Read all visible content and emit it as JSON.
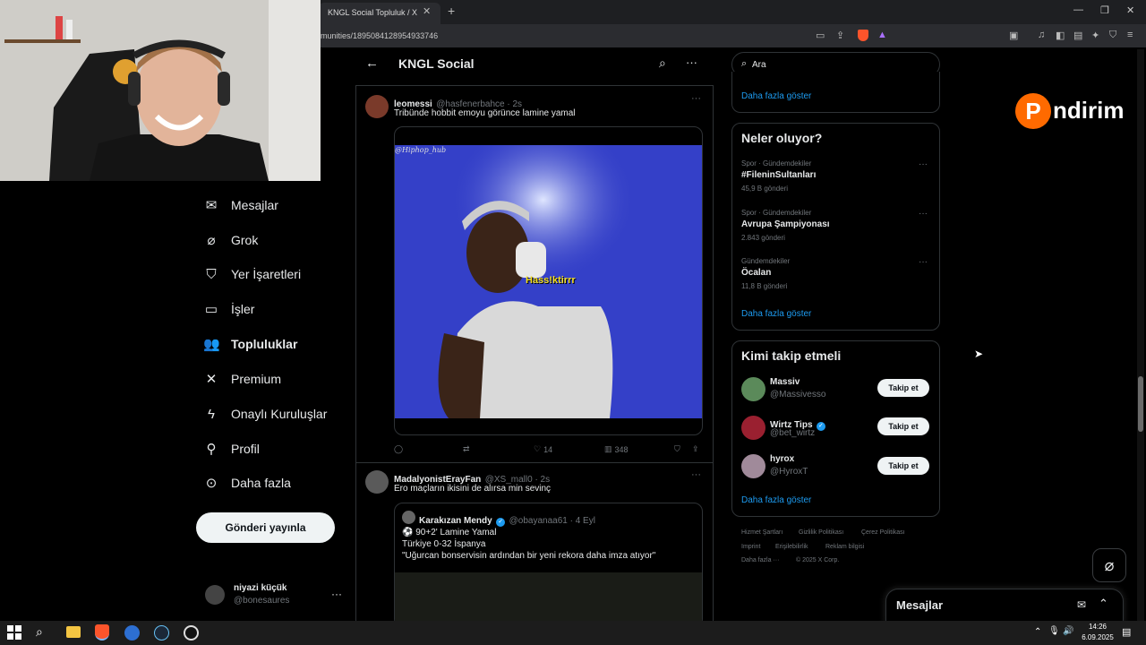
{
  "browser": {
    "tab_title": "KNGL Social Topluluk / X",
    "url": "munities/1895084128954933746"
  },
  "nav": {
    "items": [
      {
        "label": "Mesajlar",
        "icon": "envelope-icon"
      },
      {
        "label": "Grok",
        "icon": "grok-icon"
      },
      {
        "label": "Yer İşaretleri",
        "icon": "bookmark-icon"
      },
      {
        "label": "İşler",
        "icon": "briefcase-icon"
      },
      {
        "label": "Topluluklar",
        "icon": "people-icon"
      },
      {
        "label": "Premium",
        "icon": "x-logo-icon"
      },
      {
        "label": "Onaylı Kuruluşlar",
        "icon": "lightning-icon"
      },
      {
        "label": "Profil",
        "icon": "person-icon"
      },
      {
        "label": "Daha fazla",
        "icon": "more-circle-icon"
      }
    ],
    "post_button": "Gönderi yayınla",
    "account_name": "niyazi küçük",
    "account_handle": "@bonesaures"
  },
  "header": {
    "title": "KNGL Social"
  },
  "tweets": [
    {
      "name": "leomessi",
      "handle": "@hasfenerbahce · 2s",
      "text": "Tribünde hobbit emoyu görünce lamine yamal",
      "media_watermark": "@Hiphop_hub",
      "media_caption": "Hass!ktirrr",
      "likes": "14",
      "views": "348"
    },
    {
      "name": "MadalyonistErayFan",
      "handle": "@XS_mall0 · 2s",
      "text": "Ero maçların ikisini de alırsa min sevinç",
      "quote": {
        "name": "Karakızan Mendy",
        "handle": "@obayanaa61 · 4 Eyl",
        "line1": "⚽ 90+2' Lamine Yamal",
        "line2": "Türkiye 0-32 İspanya",
        "line3": "\"Uğurcan bonservisin ardından bir yeni rekora daha imza atıyor\""
      }
    }
  ],
  "search": {
    "placeholder": "Ara"
  },
  "show_more": "Daha fazla göster",
  "trends": {
    "title": "Neler oluyor?",
    "items": [
      {
        "meta": "Spor · Gündemdekiler",
        "name": "#FileninSultanları",
        "count": "45,9 B gönderi"
      },
      {
        "meta": "Spor · Gündemdekiler",
        "name": "Avrupa Şampiyonası",
        "count": "2.843 gönderi"
      },
      {
        "meta": "Gündemdekiler",
        "name": "Öcalan",
        "count": "11,8 B gönderi"
      }
    ]
  },
  "who_to_follow": {
    "title": "Kimi takip etmeli",
    "button": "Takip et",
    "items": [
      {
        "name": "Massiv",
        "handle": "@Massivesso"
      },
      {
        "name": "Wirtz Tips",
        "handle": "@bet_wirtz"
      },
      {
        "name": "hyrox",
        "handle": "@HyroxT"
      }
    ]
  },
  "footer": {
    "links": [
      "Hizmet Şartları",
      "Gizlilik Politikası",
      "Çerez Politikası",
      "Imprint",
      "Erişilebilirlik",
      "Reklam bilgisi",
      "Daha fazla ···",
      "© 2025 X Corp."
    ]
  },
  "messages_drawer": {
    "title": "Mesajlar"
  },
  "overlay": {
    "brand": "ndirim"
  },
  "taskbar": {
    "time": "14:26",
    "date": "6.09.2025"
  },
  "colors": {
    "accent": "#1d9bf0",
    "brand_orange": "#ff6a00"
  }
}
